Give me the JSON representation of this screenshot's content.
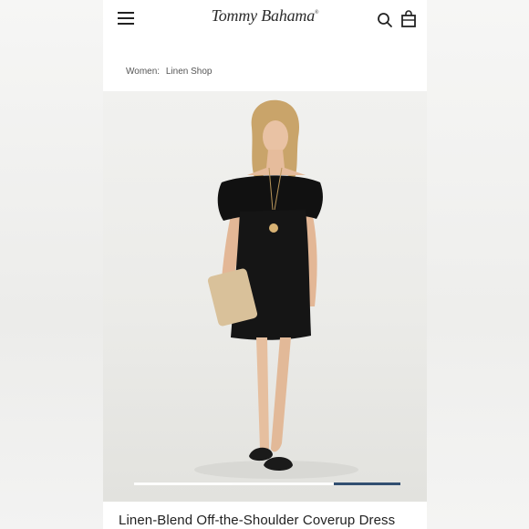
{
  "header": {
    "brand": "Tommy Bahama",
    "brand_mark": "®",
    "icons": [
      "menu-icon",
      "search-icon",
      "shopping-bag-icon"
    ]
  },
  "breadcrumb": {
    "items": [
      "Women:",
      "Linen Shop"
    ]
  },
  "product": {
    "image_alt_icon": "product-photo",
    "title": "Linen-Blend Off-the-Shoulder Coverup Dress"
  },
  "carousel": {
    "progress_fraction": 0.25,
    "active_index_from_end": 1
  },
  "colors": {
    "accent": "#1f3f66",
    "text": "#222222",
    "dress": "#111111"
  }
}
